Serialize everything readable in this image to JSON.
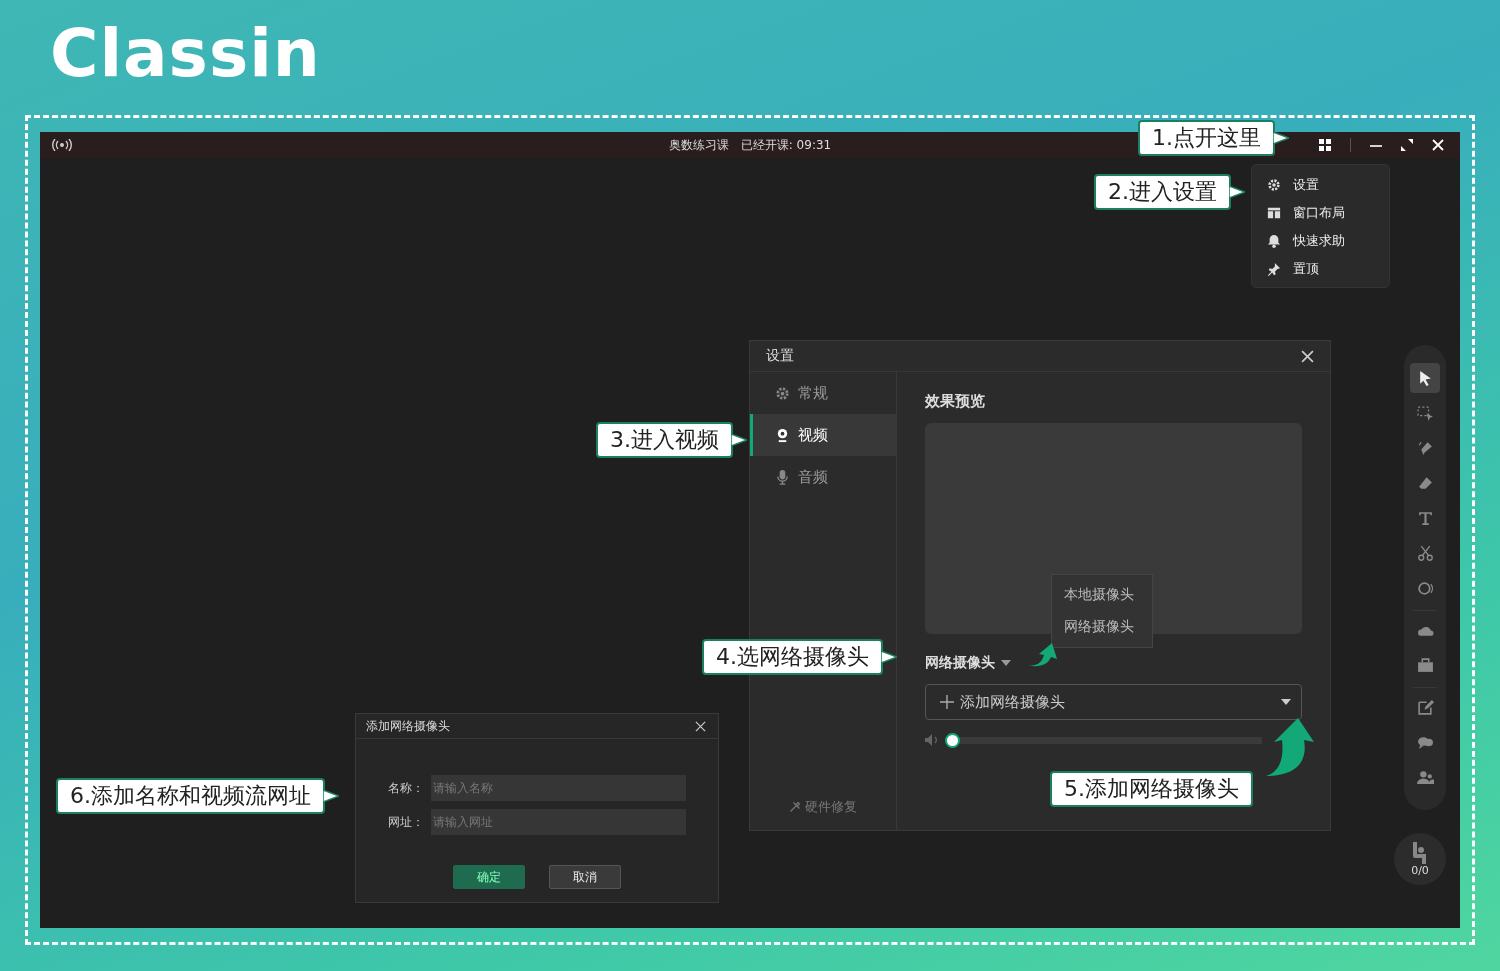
{
  "logo": {
    "text": "Classin"
  },
  "window": {
    "title": "奥数练习课",
    "status": "已经开课: 09:31"
  },
  "app_menu": {
    "items": [
      {
        "label": "设置"
      },
      {
        "label": "窗口布局"
      },
      {
        "label": "快速求助"
      },
      {
        "label": "置顶"
      }
    ]
  },
  "settings_dialog": {
    "title": "设置",
    "nav": [
      {
        "label": "常规",
        "selected": false
      },
      {
        "label": "视频",
        "selected": true
      },
      {
        "label": "音频",
        "selected": false
      }
    ],
    "repair": "硬件修复",
    "preview_title": "效果预览",
    "camera_menu": [
      {
        "label": "本地摄像头"
      },
      {
        "label": "网络摄像头"
      }
    ],
    "camera_type": "网络摄像头",
    "add_camera": "添加网络摄像头",
    "volume": {
      "level": 0
    }
  },
  "add_camera_dialog": {
    "title": "添加网络摄像头",
    "fields": [
      {
        "label": "名称：",
        "placeholder": "请输入名称"
      },
      {
        "label": "网址：",
        "placeholder": "请输入网址"
      }
    ],
    "buttons": [
      {
        "label": "确定",
        "kind": "primary"
      },
      {
        "label": "取消",
        "kind": "secondary"
      }
    ]
  },
  "toolbar": {
    "tools": [
      {
        "selected": true
      },
      {
        "selected": false
      },
      {
        "selected": false
      },
      {
        "selected": false
      },
      {
        "selected": false
      },
      {
        "selected": false
      },
      {
        "selected": false
      },
      {
        "selected": false
      },
      {
        "selected": false
      },
      {
        "selected": false
      },
      {
        "selected": false
      },
      {
        "selected": false
      }
    ]
  },
  "counter": "0/0",
  "callouts": [
    {
      "text": "1.点开这里"
    },
    {
      "text": "2.进入设置"
    },
    {
      "text": "3.进入视频"
    },
    {
      "text": "4.选网络摄像头"
    },
    {
      "text": "6.添加名称和视频流网址"
    },
    {
      "text": "5.添加网络摄像头"
    }
  ]
}
